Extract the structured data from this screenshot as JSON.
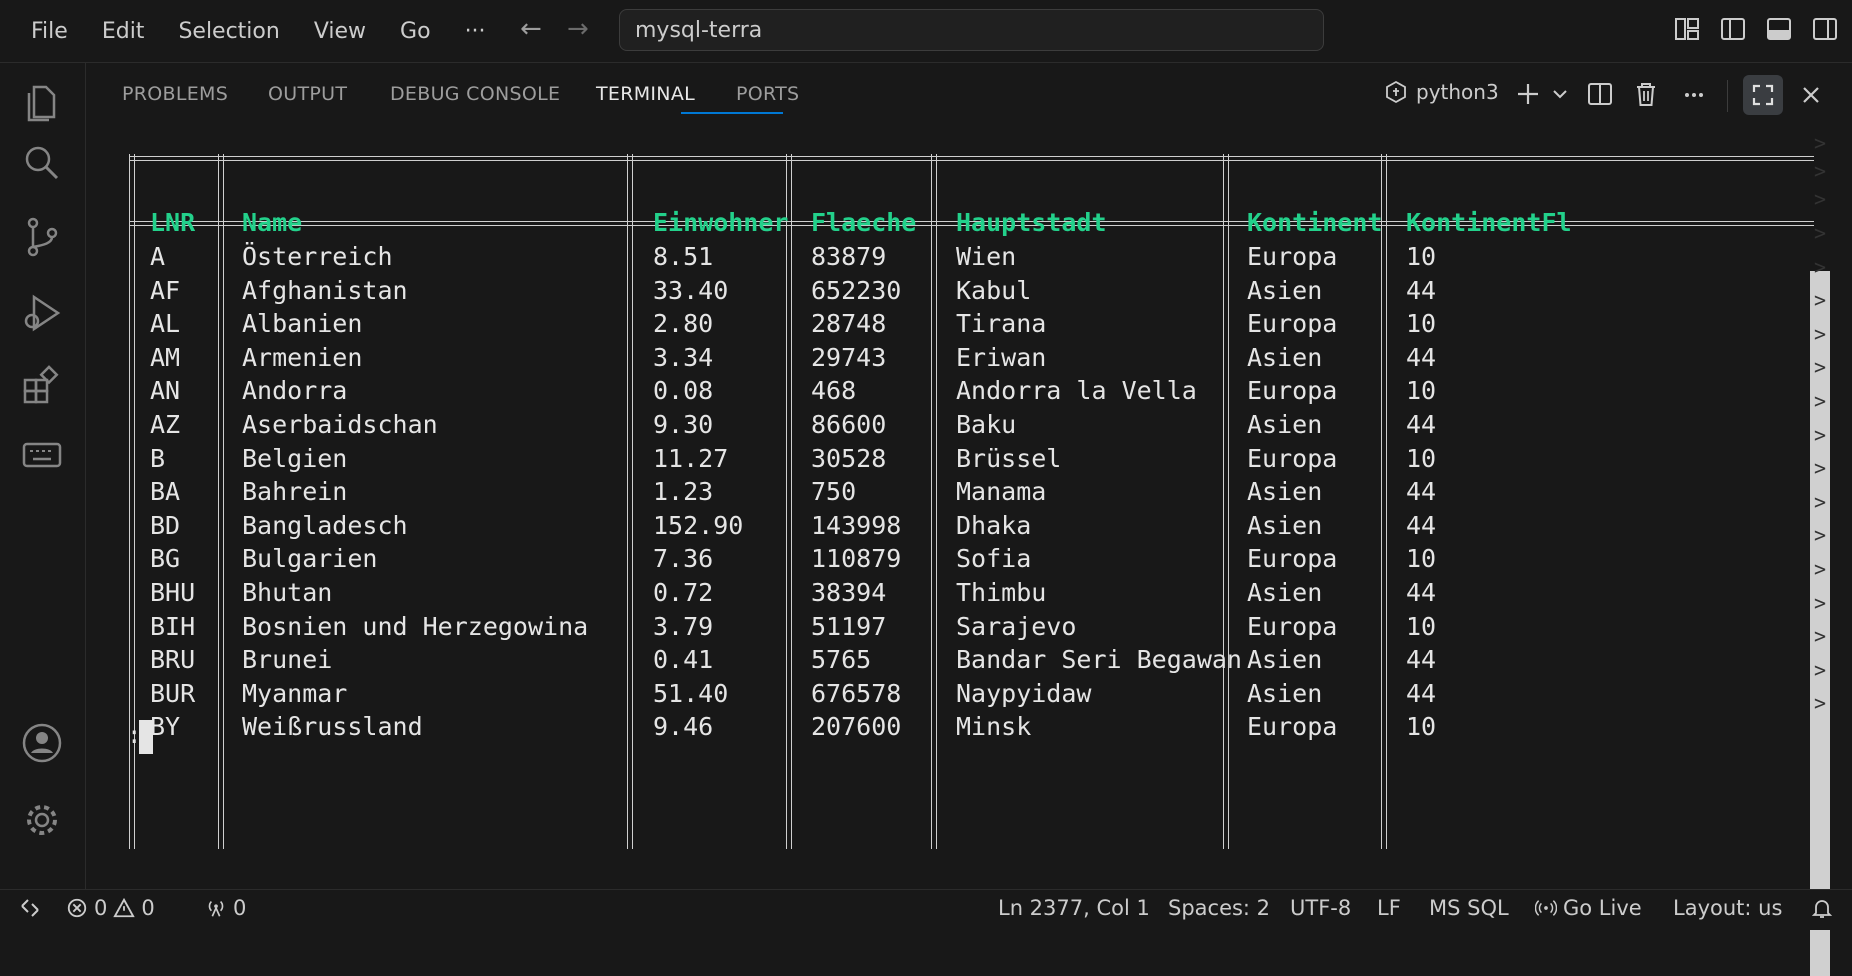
{
  "menu": [
    "File",
    "Edit",
    "Selection",
    "View",
    "Go",
    "···"
  ],
  "command_center": {
    "value": "mysql-terra"
  },
  "panel": {
    "tabs": [
      "PROBLEMS",
      "OUTPUT",
      "DEBUG CONSOLE",
      "TERMINAL",
      "PORTS"
    ],
    "active_tab": "TERMINAL",
    "terminal_name": "python3"
  },
  "table": {
    "columns": [
      "LNR",
      "Name",
      "Einwohner",
      "Flaeche",
      "Hauptstadt",
      "Kontinent",
      "KontinentFl"
    ],
    "rows": [
      [
        "A",
        "Österreich",
        "8.51",
        "83879",
        "Wien",
        "Europa",
        "10"
      ],
      [
        "AF",
        "Afghanistan",
        "33.40",
        "652230",
        "Kabul",
        "Asien",
        "44"
      ],
      [
        "AL",
        "Albanien",
        "2.80",
        "28748",
        "Tirana",
        "Europa",
        "10"
      ],
      [
        "AM",
        "Armenien",
        "3.34",
        "29743",
        "Eriwan",
        "Asien",
        "44"
      ],
      [
        "AN",
        "Andorra",
        "0.08",
        "468",
        "Andorra la Vella",
        "Europa",
        "10"
      ],
      [
        "AZ",
        "Aserbaidschan",
        "9.30",
        "86600",
        "Baku",
        "Asien",
        "44"
      ],
      [
        "B",
        "Belgien",
        "11.27",
        "30528",
        "Brüssel",
        "Europa",
        "10"
      ],
      [
        "BA",
        "Bahrein",
        "1.23",
        "750",
        "Manama",
        "Asien",
        "44"
      ],
      [
        "BD",
        "Bangladesch",
        "152.90",
        "143998",
        "Dhaka",
        "Asien",
        "44"
      ],
      [
        "BG",
        "Bulgarien",
        "7.36",
        "110879",
        "Sofia",
        "Europa",
        "10"
      ],
      [
        "BHU",
        "Bhutan",
        "0.72",
        "38394",
        "Thimbu",
        "Asien",
        "44"
      ],
      [
        "BIH",
        "Bosnien und Herzegowina",
        "3.79",
        "51197",
        "Sarajevo",
        "Europa",
        "10"
      ],
      [
        "BRU",
        "Brunei",
        "0.41",
        "5765",
        "Bandar Seri Begawan",
        "Asien",
        "44"
      ],
      [
        "BUR",
        "Myanmar",
        "51.40",
        "676578",
        "Naypyidaw",
        "Asien",
        "44"
      ],
      [
        "BY",
        "Weißrussland",
        "9.46",
        "207600",
        "Minsk",
        "Europa",
        "10"
      ]
    ],
    "overflow_marker": ">"
  },
  "prompt": ":",
  "status": {
    "errors": "0",
    "warnings": "0",
    "ports": "0",
    "position": "Ln 2377, Col 1",
    "spaces": "Spaces: 2",
    "encoding": "UTF-8",
    "eol": "LF",
    "language": "MS SQL",
    "go_live": "Go Live",
    "layout": "Layout: us"
  },
  "colors": {
    "header_green": "#23d18b",
    "accent": "#0078d4",
    "background": "#181818"
  },
  "icons": [
    "explorer-icon",
    "search-icon",
    "source-control-icon",
    "run-debug-icon",
    "extensions-icon",
    "keyboard-icon",
    "account-icon",
    "settings-icon"
  ]
}
